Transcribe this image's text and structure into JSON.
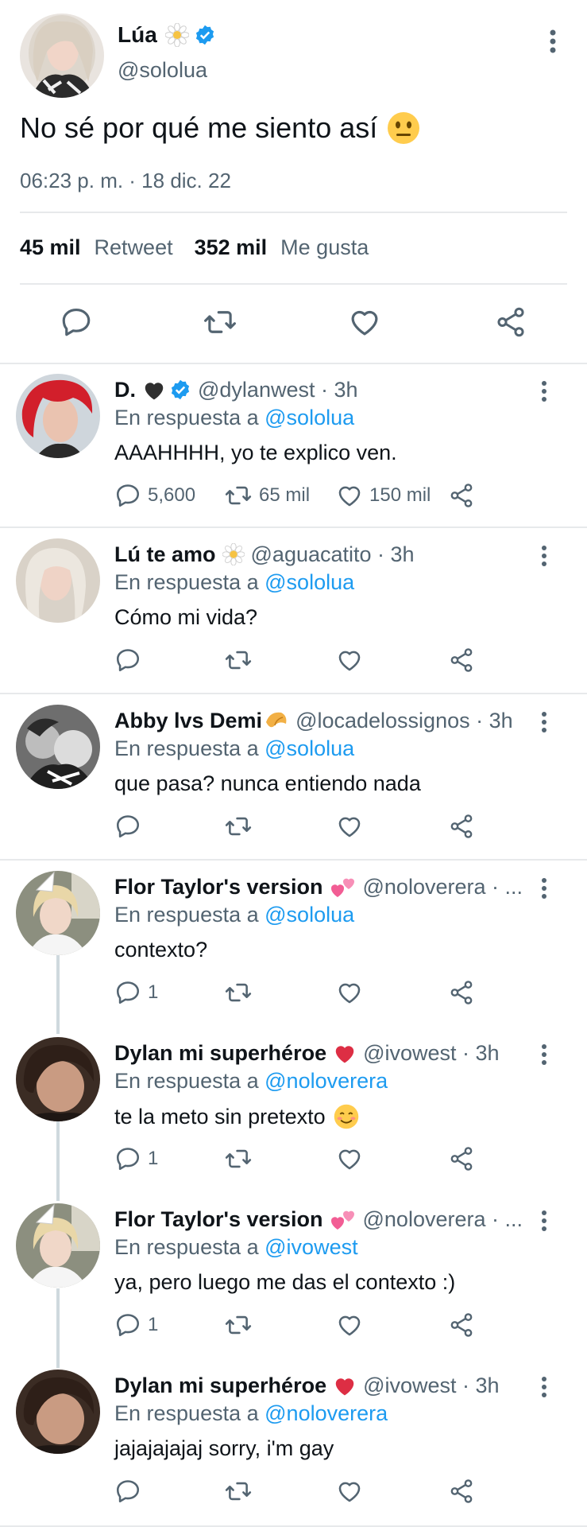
{
  "main_tweet": {
    "name": "Lúa",
    "handle": "@sololua",
    "text": "No sé por qué me siento así",
    "timestamp": "06:23 p. m. · 18 dic. 22",
    "retweets_count": "45 mil",
    "retweets_label": "Retweet",
    "likes_count": "352 mil",
    "likes_label": "Me gusta"
  },
  "replies": [
    {
      "name": "D.",
      "handle": "@dylanwest · 3h",
      "in_reply_prefix": "En respuesta a",
      "in_reply_to": "@sololua",
      "text": "AAAHHHH, yo te explico ven.",
      "reply_count": "5,600",
      "retweet_count": "65 mil",
      "like_count": "150 mil"
    },
    {
      "name": "Lú te amo",
      "handle": "@aguacatito · 3h",
      "in_reply_prefix": "En respuesta a",
      "in_reply_to": "@sololua",
      "text": "Cómo mi vida?",
      "reply_count": "",
      "retweet_count": "",
      "like_count": ""
    },
    {
      "name": "Abby lvs Demi",
      "handle": "@locadelossignos · 3h",
      "in_reply_prefix": "En respuesta a",
      "in_reply_to": "@sololua",
      "text": "que pasa? nunca entiendo nada",
      "reply_count": "",
      "retweet_count": "",
      "like_count": ""
    },
    {
      "name": "Flor Taylor's version",
      "handle": "@noloverera · ...",
      "in_reply_prefix": "En respuesta a",
      "in_reply_to": "@sololua",
      "text": "contexto?",
      "reply_count": "1",
      "retweet_count": "",
      "like_count": ""
    },
    {
      "name": "Dylan mi superhéroe",
      "handle": "@ivowest · 3h",
      "in_reply_prefix": "En respuesta a",
      "in_reply_to": "@noloverera",
      "text": "te la meto sin pretexto",
      "reply_count": "1",
      "retweet_count": "",
      "like_count": ""
    },
    {
      "name": "Flor Taylor's version",
      "handle": "@noloverera · ...",
      "in_reply_prefix": "En respuesta a",
      "in_reply_to": "@ivowest",
      "text": "ya, pero luego me das el contexto :)",
      "reply_count": "1",
      "retweet_count": "",
      "like_count": ""
    },
    {
      "name": "Dylan mi superhéroe",
      "handle": "@ivowest · 3h",
      "in_reply_prefix": "En respuesta a",
      "in_reply_to": "@noloverera",
      "text": "jajajajajaj sorry, i'm gay",
      "reply_count": "",
      "retweet_count": "",
      "like_count": ""
    }
  ],
  "colors": {
    "accent": "#1d9bf0",
    "secondary_text": "#536471",
    "divider": "#e7e9eb"
  }
}
